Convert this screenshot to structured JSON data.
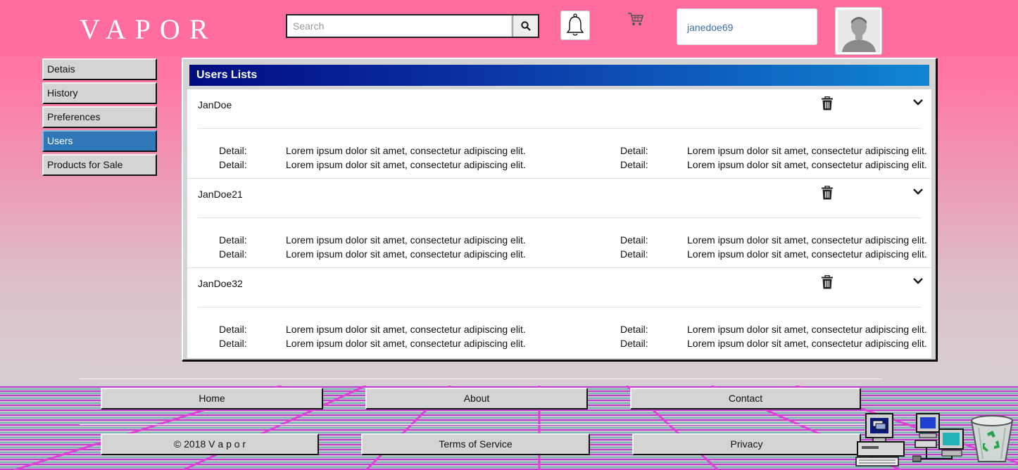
{
  "header": {
    "logo": "VAPOR",
    "search_placeholder": "Search",
    "username": "janedoe69"
  },
  "sidebar": {
    "items": [
      {
        "label": "Detais",
        "active": false
      },
      {
        "label": "History",
        "active": false
      },
      {
        "label": "Preferences",
        "active": false
      },
      {
        "label": "Users",
        "active": true
      },
      {
        "label": "Products for Sale",
        "active": false
      }
    ]
  },
  "panel": {
    "title": "Users Lists",
    "users": [
      {
        "name": "JanDoe",
        "details": [
          {
            "label": "Detail:",
            "text": "Lorem ipsum dolor sit amet, consectetur adipiscing elit."
          },
          {
            "label": "Detail:",
            "text": "Lorem ipsum dolor sit amet, consectetur adipiscing elit."
          },
          {
            "label": "Detail:",
            "text": "Lorem ipsum dolor sit amet, consectetur adipiscing elit."
          },
          {
            "label": "Detail:",
            "text": "Lorem ipsum dolor sit amet, consectetur adipiscing elit."
          }
        ]
      },
      {
        "name": "JanDoe21",
        "details": [
          {
            "label": "Detail:",
            "text": "Lorem ipsum dolor sit amet, consectetur adipiscing elit."
          },
          {
            "label": "Detail:",
            "text": "Lorem ipsum dolor sit amet, consectetur adipiscing elit."
          },
          {
            "label": "Detail:",
            "text": "Lorem ipsum dolor sit amet, consectetur adipiscing elit."
          },
          {
            "label": "Detail:",
            "text": "Lorem ipsum dolor sit amet, consectetur adipiscing elit."
          }
        ]
      },
      {
        "name": "JanDoe32",
        "details": [
          {
            "label": "Detail:",
            "text": "Lorem ipsum dolor sit amet, consectetur adipiscing elit."
          },
          {
            "label": "Detail:",
            "text": "Lorem ipsum dolor sit amet, consectetur adipiscing elit."
          },
          {
            "label": "Detail:",
            "text": "Lorem ipsum dolor sit amet, consectetur adipiscing elit."
          },
          {
            "label": "Detail:",
            "text": "Lorem ipsum dolor sit amet, consectetur adipiscing elit."
          }
        ]
      }
    ]
  },
  "footer": {
    "home": "Home",
    "about": "About",
    "contact": "Contact",
    "copyright": "© 2018 V a p o r",
    "terms": "Terms of Service",
    "privacy": "Privacy"
  },
  "icons": {
    "search": "search-icon",
    "bell": "bell-icon",
    "cart": "cart-icon",
    "avatar": "avatar-icon",
    "trash": "trash-icon",
    "chevron": "chevron-down-icon",
    "desktop": [
      "my-computer-icon",
      "network-icon",
      "recycle-bin-icon"
    ]
  },
  "colors": {
    "header_bg": "#ff6d9d",
    "title_start": "#000c80",
    "title_end": "#1086d2",
    "active_item": "#2f77b6",
    "grid_line": "#e040d8"
  }
}
